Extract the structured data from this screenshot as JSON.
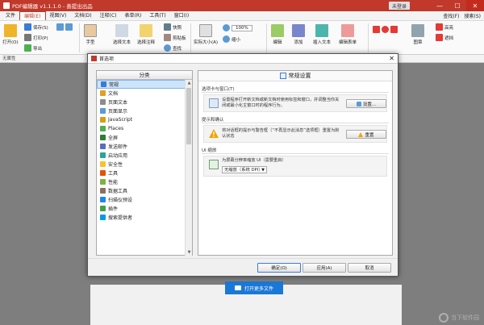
{
  "window": {
    "title": "PDF编辑器 v1.1.1.0 - 善提出出品",
    "login": "未登录",
    "min": "—",
    "max": "☐",
    "close": "✕"
  },
  "menu": {
    "items": [
      "文件",
      "编辑(E)",
      "视图(V)",
      "文档(D)",
      "注释(C)",
      "表单(R)",
      "工具(T)",
      "窗口(I)"
    ],
    "right": [
      "查找(F)",
      "搜索(S)"
    ]
  },
  "ribbon": {
    "open": "打开(O)",
    "save": "保存(S)",
    "print": "打印(P)",
    "export": "导出",
    "hand": "手型",
    "select_text": "选择文本",
    "select_annot": "选择注释",
    "snapshot": "快照",
    "clipboard": "剪贴板",
    "find": "查找",
    "actual_size": "实际大小(A)",
    "zoom": "100%",
    "fit": "缩小",
    "edit": "编辑",
    "add": "添加",
    "insert_text": "插入文本",
    "edit_form": "编辑表单",
    "stamp": "图章",
    "highlight": "高亮",
    "redact": "遮挡"
  },
  "status_left": "无属性",
  "dialog": {
    "title": "首选项",
    "close": "✕",
    "category_header": "分类",
    "categories": [
      {
        "label": "常规",
        "color": "#3a7bd5",
        "selected": true
      },
      {
        "label": "文档",
        "color": "#e0a020",
        "selected": false
      },
      {
        "label": "页面文本",
        "color": "#8c8c8c",
        "selected": false
      },
      {
        "label": "页面显示",
        "color": "#5b9bd5",
        "selected": false
      },
      {
        "label": "JavaScript",
        "color": "#d4a017",
        "selected": false
      },
      {
        "label": "Places",
        "color": "#4caf50",
        "selected": false
      },
      {
        "label": "全屏",
        "color": "#2e7d32",
        "selected": false
      },
      {
        "label": "发送邮件",
        "color": "#5c6bc0",
        "selected": false
      },
      {
        "label": "启动应用",
        "color": "#26a69a",
        "selected": false
      },
      {
        "label": "安全性",
        "color": "#fbc02d",
        "selected": false
      },
      {
        "label": "工具",
        "color": "#e65100",
        "selected": false
      },
      {
        "label": "性能",
        "color": "#7cb342",
        "selected": false
      },
      {
        "label": "数据工具",
        "color": "#8d6e63",
        "selected": false
      },
      {
        "label": "扫描仪预设",
        "color": "#1e88e5",
        "selected": false
      },
      {
        "label": "插件",
        "color": "#43a047",
        "selected": false
      },
      {
        "label": "搜索提供者",
        "color": "#039be5",
        "selected": false
      }
    ],
    "settings_header": "常规设置",
    "sections": {
      "tabs": {
        "title": "选项卡与窗口(T)",
        "text": "设置程序打开新文档或新文档时使用标签和窗口，并调整当你关闭或最小化主窗口时的程序行为。",
        "button": "设置..."
      },
      "prompts": {
        "title": "提示和确认",
        "text": "将对话框的提示与警告框（“不再显示此消息”选项框）重置为默认状态",
        "button": "重置"
      },
      "ui_scale": {
        "title": "UI 缩放",
        "text": "为屏幕分辨率缩放 UI（需要重启）",
        "select_value": "无缩放（系统 DPI）"
      }
    },
    "ok": "确定(O)",
    "apply": "应用(A)",
    "cancel": "取消"
  },
  "open_more": "打开更多文件",
  "watermark": "当下软件园"
}
